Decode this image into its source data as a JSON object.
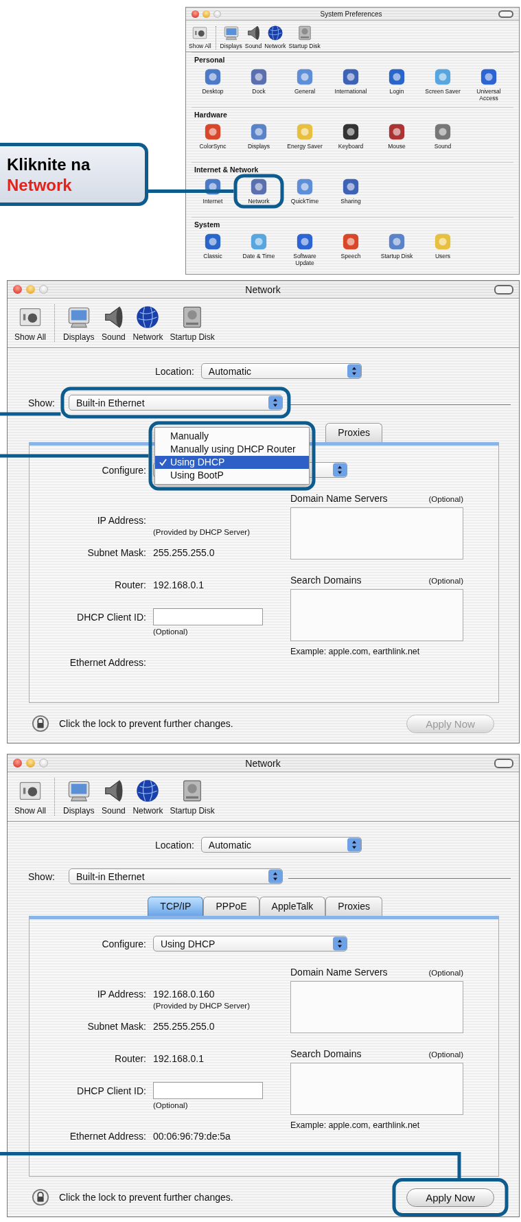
{
  "callout": {
    "prefix": "Kliknite na",
    "target": "Network"
  },
  "system_preferences": {
    "title": "System Preferences",
    "toolbar": [
      {
        "label": "Show All"
      },
      {
        "label": "Displays"
      },
      {
        "label": "Sound"
      },
      {
        "label": "Network"
      },
      {
        "label": "Startup Disk"
      }
    ],
    "sections": [
      {
        "title": "Personal",
        "items": [
          {
            "label": "Desktop",
            "highlighted": false
          },
          {
            "label": "Dock",
            "highlighted": false
          },
          {
            "label": "General",
            "highlighted": false
          },
          {
            "label": "International",
            "highlighted": false
          },
          {
            "label": "Login",
            "highlighted": false
          },
          {
            "label": "Screen Saver",
            "highlighted": false
          },
          {
            "label": "Universal Access",
            "highlighted": false
          }
        ]
      },
      {
        "title": "Hardware",
        "items": [
          {
            "label": "ColorSync",
            "highlighted": false
          },
          {
            "label": "Displays",
            "highlighted": false
          },
          {
            "label": "Energy Saver",
            "highlighted": false
          },
          {
            "label": "Keyboard",
            "highlighted": false
          },
          {
            "label": "Mouse",
            "highlighted": false
          },
          {
            "label": "Sound",
            "highlighted": false
          }
        ]
      },
      {
        "title": "Internet & Network",
        "items": [
          {
            "label": "Internet",
            "highlighted": false
          },
          {
            "label": "Network",
            "highlighted": true
          },
          {
            "label": "QuickTime",
            "highlighted": false
          },
          {
            "label": "Sharing",
            "highlighted": false
          }
        ]
      },
      {
        "title": "System",
        "items": [
          {
            "label": "Classic",
            "highlighted": false
          },
          {
            "label": "Date & Time",
            "highlighted": false
          },
          {
            "label": "Software Update",
            "highlighted": false
          },
          {
            "label": "Speech",
            "highlighted": false
          },
          {
            "label": "Startup Disk",
            "highlighted": false
          },
          {
            "label": "Users",
            "highlighted": false
          }
        ]
      }
    ]
  },
  "network_windows": [
    {
      "title": "Network",
      "toolbar": [
        {
          "label": "Show All"
        },
        {
          "label": "Displays"
        },
        {
          "label": "Sound"
        },
        {
          "label": "Network"
        },
        {
          "label": "Startup Disk"
        }
      ],
      "location": {
        "label": "Location:",
        "value": "Automatic"
      },
      "show": {
        "label": "Show:",
        "value": "Built-in Ethernet",
        "highlighted": true
      },
      "tabs": [
        {
          "label": "Proxies",
          "selected": false
        }
      ],
      "configure": {
        "label": "Configure:"
      },
      "configure_menu": {
        "highlighted": true,
        "items": [
          {
            "label": "Manually",
            "selected": false
          },
          {
            "label": "Manually using DHCP Router",
            "selected": false
          },
          {
            "label": "Using DHCP",
            "selected": true
          },
          {
            "label": "Using BootP",
            "selected": false
          }
        ]
      },
      "fields": [
        {
          "kind": "text",
          "label": "IP Address:",
          "note": "(Provided by DHCP Server)"
        },
        {
          "kind": "text",
          "label": "Subnet Mask:",
          "value": "255.255.255.0"
        },
        {
          "kind": "text",
          "label": "Router:",
          "value": "192.168.0.1"
        },
        {
          "kind": "input",
          "label": "DHCP Client ID:",
          "note": "(Optional)"
        },
        {
          "kind": "text",
          "label": "Ethernet Address:"
        }
      ],
      "dns": {
        "label": "Domain Name Servers",
        "note": "(Optional)"
      },
      "search_domains": {
        "label": "Search Domains",
        "note": "(Optional)",
        "example": "Example: apple.com, earthlink.net"
      },
      "lock_text": "Click the lock to prevent further changes.",
      "apply_button": {
        "label": "Apply Now",
        "disabled": true
      }
    },
    {
      "title": "Network",
      "toolbar": [
        {
          "label": "Show All"
        },
        {
          "label": "Displays"
        },
        {
          "label": "Sound"
        },
        {
          "label": "Network"
        },
        {
          "label": "Startup Disk"
        }
      ],
      "location": {
        "label": "Location:",
        "value": "Automatic"
      },
      "show": {
        "label": "Show:",
        "value": "Built-in Ethernet"
      },
      "tabs": [
        {
          "label": "TCP/IP",
          "selected": true
        },
        {
          "label": "PPPoE",
          "selected": false
        },
        {
          "label": "AppleTalk",
          "selected": false
        },
        {
          "label": "Proxies",
          "selected": false
        }
      ],
      "configure": {
        "label": "Configure:",
        "value": "Using DHCP"
      },
      "fields": [
        {
          "kind": "text",
          "label": "IP Address:",
          "value": "192.168.0.160",
          "note": "(Provided by DHCP Server)"
        },
        {
          "kind": "text",
          "label": "Subnet Mask:",
          "value": "255.255.255.0"
        },
        {
          "kind": "text",
          "label": "Router:",
          "value": "192.168.0.1"
        },
        {
          "kind": "input",
          "label": "DHCP Client ID:",
          "note": "(Optional)"
        },
        {
          "kind": "text",
          "label": "Ethernet Address:",
          "value": "00:06:96:79:de:5a"
        }
      ],
      "dns": {
        "label": "Domain Name Servers",
        "note": "(Optional)"
      },
      "search_domains": {
        "label": "Search Domains",
        "note": "(Optional)",
        "example": "Example: apple.com, earthlink.net"
      },
      "lock_text": "Click the lock to prevent further changes.",
      "apply_button": {
        "label": "Apply Now",
        "disabled": false,
        "highlighted": true
      }
    }
  ]
}
